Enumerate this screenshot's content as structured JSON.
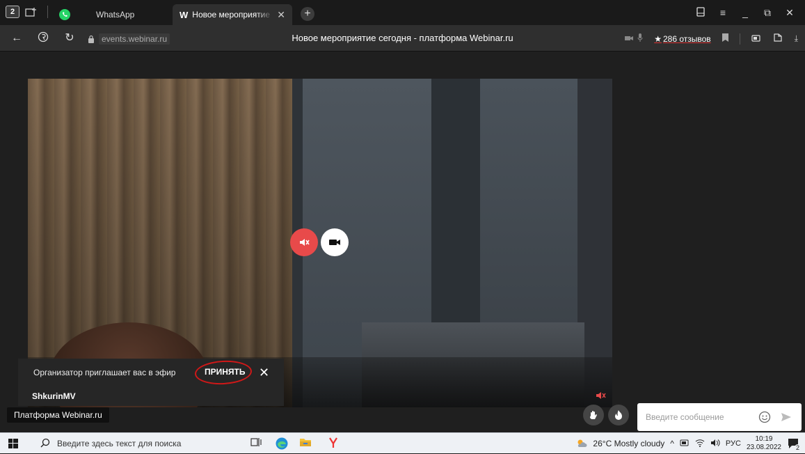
{
  "browser": {
    "tab_count": "2",
    "tabs": [
      {
        "label": "WhatsApp"
      },
      {
        "label": "Новое мероприятие се",
        "favicon_letter": "W"
      }
    ],
    "url": "events.webinar.ru",
    "page_title": "Новое мероприятие сегодня - платформа Webinar.ru",
    "reviews": "286 отзывов"
  },
  "meeting": {
    "invite_text": "Организатор приглашает вас в эфир",
    "accept_label": "ПРИНЯТЬ",
    "participant_name": "ShkurinMV",
    "platform_badge": "Платформа Webinar.ru",
    "chat_placeholder": "Введите сообщение"
  },
  "taskbar": {
    "search_placeholder": "Введите здесь текст для поиска",
    "weather": "26°C  Mostly cloudy",
    "language": "РУС",
    "time": "10:19",
    "date": "23.08.2022",
    "notifications": "2"
  },
  "colors": {
    "mute_active": "#e84a4a",
    "accent_reviews_underline": "#dd3333",
    "annotation_circle": "#d01818"
  },
  "icons": [
    "tab-count-icon",
    "new-tab-group-icon",
    "whatsapp-icon",
    "close-icon",
    "plus-icon",
    "back-icon",
    "yandex-icon",
    "refresh-icon",
    "lock-icon",
    "camera-small-icon",
    "mic-small-icon",
    "star-icon",
    "bookmark-icon",
    "battery-icon",
    "shield-icon",
    "download-icon",
    "mic-muted-icon",
    "video-camera-icon",
    "raise-hand-icon",
    "fire-icon",
    "emoji-icon",
    "send-icon",
    "windows-start-icon",
    "search-icon",
    "task-view-icon",
    "edge-icon",
    "file-explorer-icon",
    "yandex-browser-icon",
    "weather-icon",
    "notification-icon"
  ]
}
